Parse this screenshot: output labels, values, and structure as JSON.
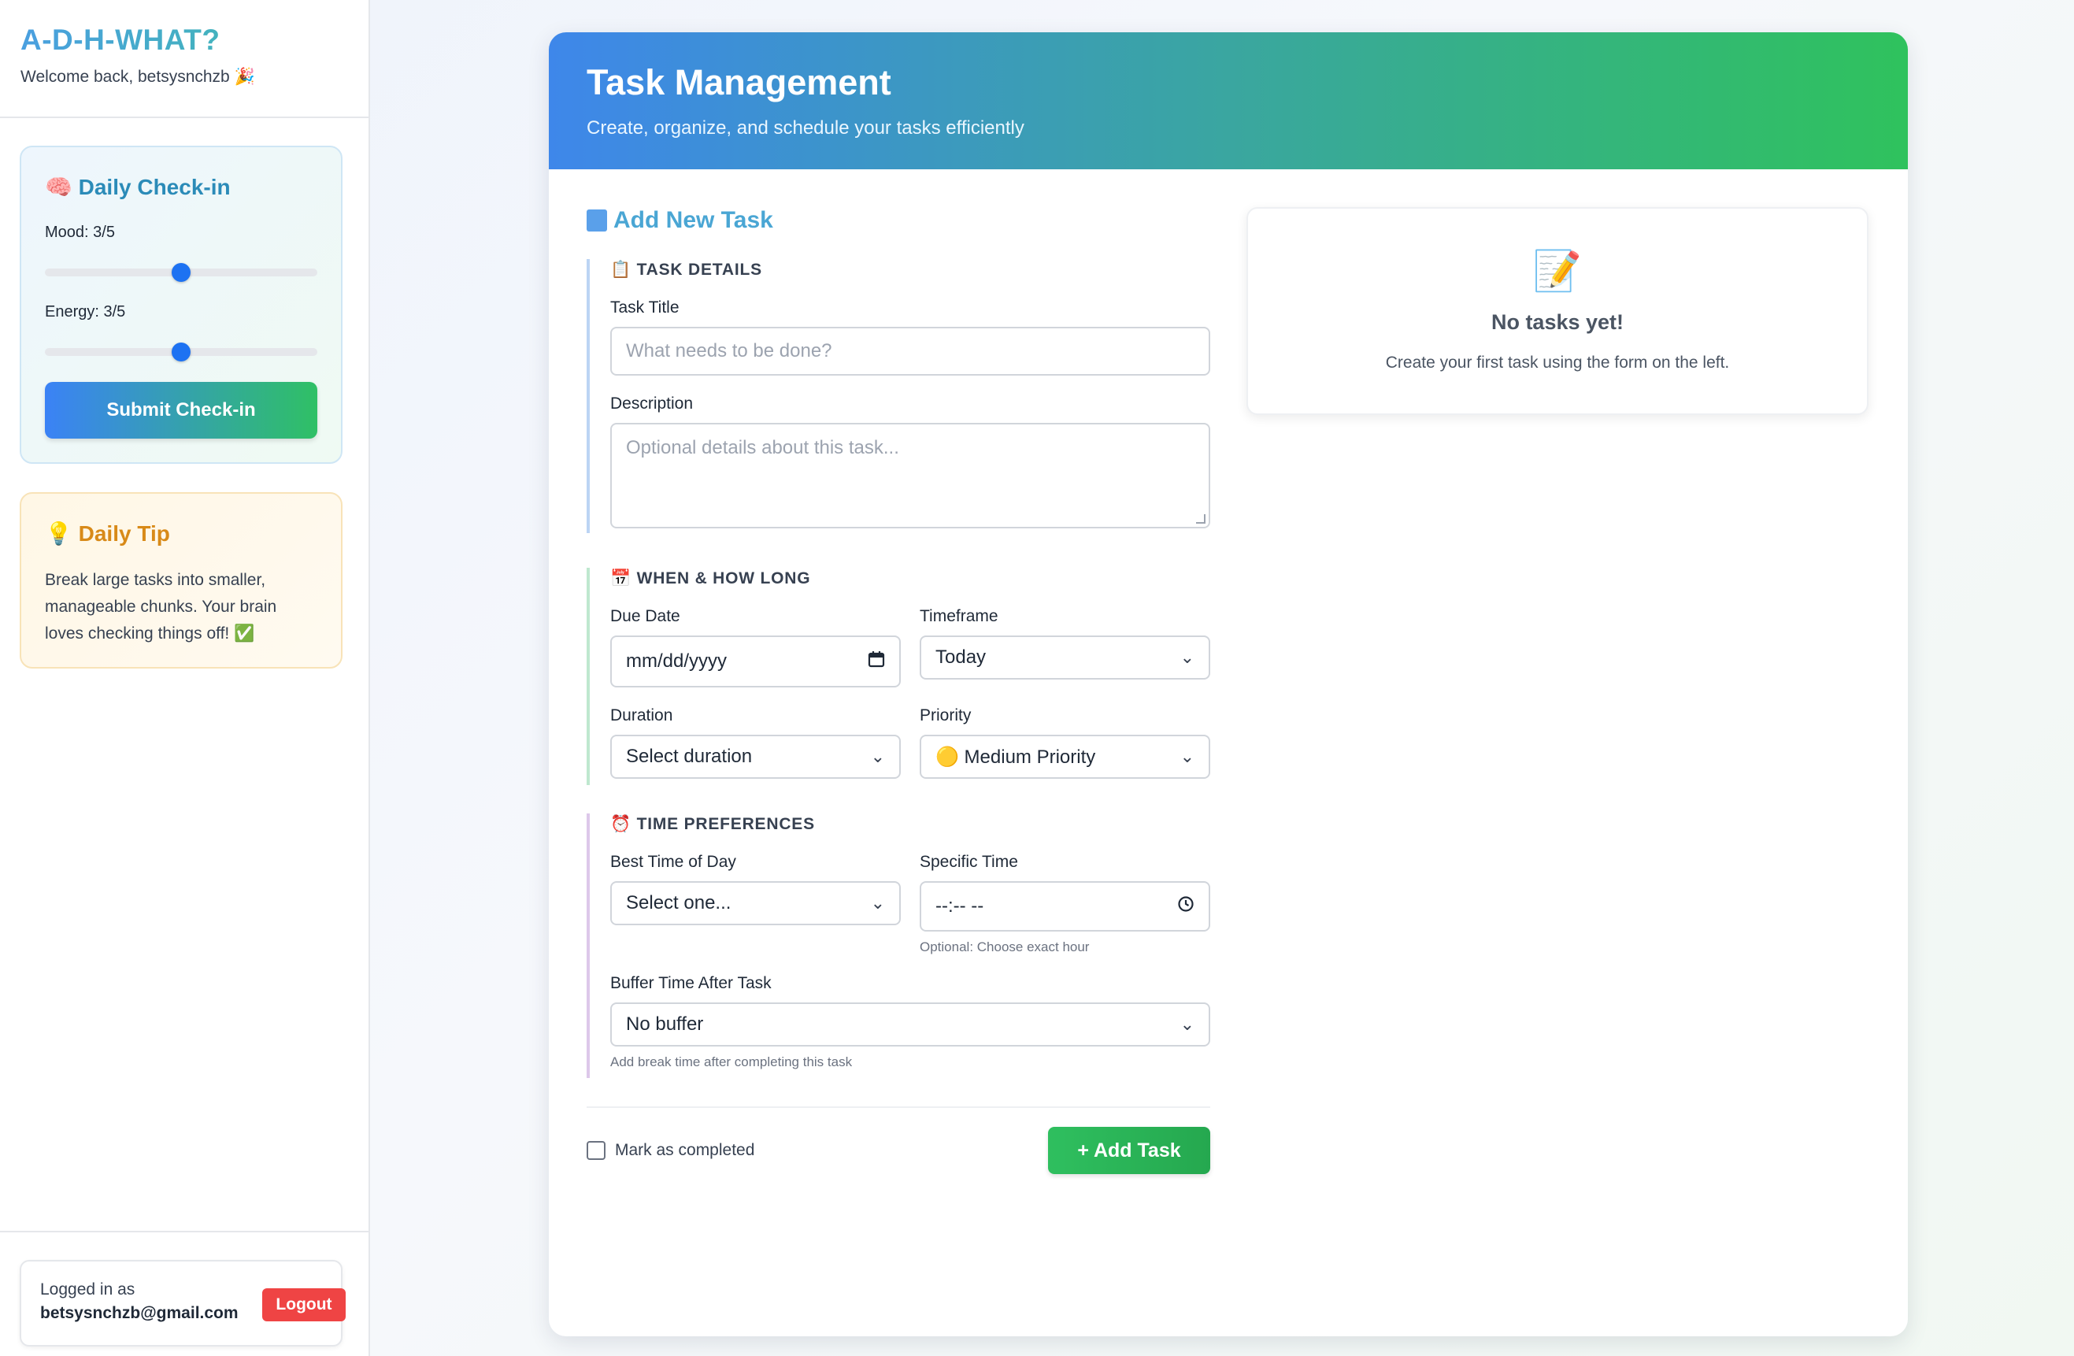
{
  "sidebar": {
    "brand": "A-D-H-WHAT?",
    "welcome": "Welcome back, betsysnchzb 🎉",
    "checkin": {
      "icon": "brain-icon",
      "title": "🧠 Daily Check-in",
      "mood_label": "Mood: 3/5",
      "mood_value": 3,
      "energy_label": "Energy: 3/5",
      "energy_value": 3,
      "scale_max": 5,
      "submit_label": "Submit Check-in"
    },
    "tip": {
      "icon": "lightbulb-icon",
      "title": "💡 Daily Tip",
      "text": "Break large tasks into smaller, manageable chunks. Your brain loves checking things off! ✅"
    },
    "account": {
      "logged_label": "Logged in as",
      "email": "betsysnchzb@gmail.com",
      "logout_label": "Logout"
    }
  },
  "main": {
    "title": "Task Management",
    "subtitle": "Create, organize, and schedule your tasks efficiently",
    "form": {
      "heading": "Add New Task",
      "details": {
        "title": "📋 TASK DETAILS",
        "task_title_label": "Task Title",
        "task_title_placeholder": "What needs to be done?",
        "description_label": "Description",
        "description_placeholder": "Optional details about this task..."
      },
      "when": {
        "title": "📅 WHEN & HOW LONG",
        "due_label": "Due Date",
        "due_value": "mm/dd/yyyy",
        "timeframe_label": "Timeframe",
        "timeframe_value": "Today",
        "duration_label": "Duration",
        "duration_value": "Select duration",
        "priority_label": "Priority",
        "priority_value": "🟡 Medium Priority"
      },
      "time": {
        "title": "⏰ TIME PREFERENCES",
        "best_label": "Best Time of Day",
        "best_value": "Select one...",
        "specific_label": "Specific Time",
        "specific_value": "--:-- --",
        "specific_helper": "Optional: Choose exact hour",
        "buffer_label": "Buffer Time After Task",
        "buffer_value": "No buffer",
        "buffer_helper": "Add break time after completing this task"
      },
      "completed_label": "Mark as completed",
      "completed_checked": false,
      "add_label": "+ Add Task"
    },
    "empty": {
      "icon": "📝",
      "title": "No tasks yet!",
      "text": "Create your first task using the form on the left."
    }
  },
  "colors": {
    "accent_blue": "#3b82f6",
    "accent_green": "#2fc065",
    "logout_red": "#ef4444"
  }
}
